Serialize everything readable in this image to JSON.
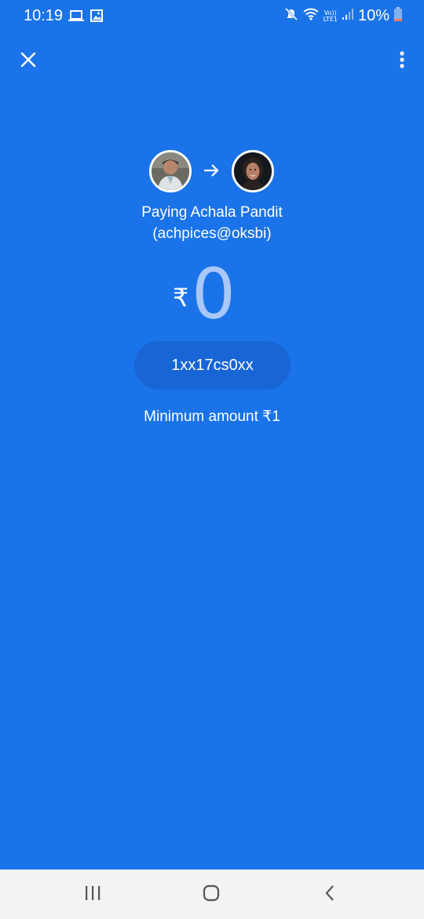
{
  "status_bar": {
    "time": "10:19",
    "network_label_top": "Vo))",
    "network_label_bottom": "LTE1",
    "battery": "10%",
    "icons": [
      "laptop-icon",
      "image-icon",
      "mute-icon",
      "wifi-icon",
      "signal-icon",
      "battery-icon"
    ]
  },
  "app_bar": {
    "close_icon": "close-icon",
    "more_icon": "more-vert-icon"
  },
  "payment": {
    "paying_line": "Paying Achala Pandit",
    "upi_id": "(achpices@oksbi)",
    "currency": "₹",
    "amount": "0",
    "note": "1xx17cs0xx",
    "minimum": "Minimum amount ₹1"
  },
  "nav_bar": {
    "icons": [
      "recents-icon",
      "home-icon",
      "back-icon"
    ]
  },
  "colors": {
    "background": "#1a73e8",
    "pill": "#1865d6",
    "amount": "#a8c7fa",
    "nav_bar": "#f3f3f5"
  }
}
